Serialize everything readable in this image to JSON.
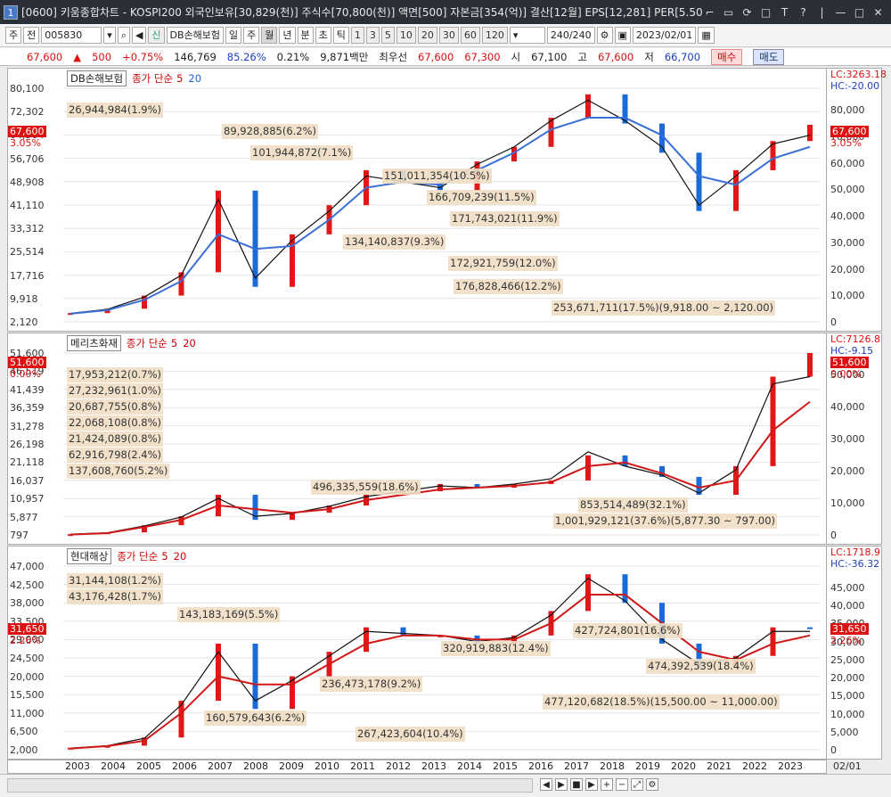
{
  "window": {
    "num": "1",
    "title": "[0600] 키움종합차트 - KOSPI200 외국인보유[30,829(천)] 주식수[70,800(천)] 액면[500] 자본금[354(억)] 결산[12월] EPS[12,281] PER[5.50] ∕",
    "controls": [
      "⌐",
      "▭",
      "⟳",
      "□",
      "T",
      "?",
      "|",
      "—",
      "□",
      "✕"
    ]
  },
  "toolbar": {
    "tab1": "주",
    "tab2": "전",
    "code": "005830",
    "name": "DB손해보험",
    "periods": [
      "일",
      "주",
      "월",
      "년",
      "분",
      "초",
      "틱"
    ],
    "selected_period": "월",
    "nums": [
      "1",
      "3",
      "5",
      "10",
      "20",
      "30",
      "60",
      "120"
    ],
    "count": "240/240",
    "date": "2023/02/01"
  },
  "quote": {
    "price": "67,600",
    "change": "500",
    "pct": "+0.75%",
    "volume": "146,769",
    "v1": "85.26%",
    "v2": "0.21%",
    "amount": "9,871백만",
    "best_label": "최우선",
    "ask": "67,600",
    "bid": "67,300",
    "open_label": "시",
    "open": "67,100",
    "high_label": "고",
    "high": "67,600",
    "low_label": "저",
    "low": "66,700",
    "buy": "매수",
    "sell": "매도"
  },
  "panes": [
    {
      "name": "DB손해보험",
      "ma_label": "종가 단순",
      "ma1": "5",
      "ma2": "20",
      "lc": "LC:3263.18",
      "hc": "HC:-20.00",
      "price_tag": "67,600",
      "pct_tag": "3.05%",
      "left_scale": [
        "80,100",
        "72,302",
        "64,504",
        "56,706",
        "48,908",
        "41,110",
        "33,312",
        "25,514",
        "17,716",
        "9,918",
        "2,120"
      ],
      "right_scale": [
        "80,000",
        "70,000",
        "60,000",
        "50,000",
        "40,000",
        "30,000",
        "20,000",
        "10,000",
        "0"
      ],
      "vols": [
        "26,944,984(1.9%)",
        "89,928,885(6.2%)",
        "101,944,872(7.1%)",
        "151,011,354(10.5%)",
        "166,709,239(11.5%)",
        "171,743,021(11.9%)",
        "134,140,837(9.3%)",
        "172,921,759(12.0%)",
        "176,828,466(12.2%)",
        "253,671,711(17.5%)(9,918.00 ~ 2,120.00)"
      ]
    },
    {
      "name": "메리츠화재",
      "ma_label": "종가 단순",
      "ma1": "5",
      "ma2": "20",
      "lc": "LC:7126.8",
      "hc": "HC:-9.15",
      "price_tag": "51,600",
      "pct_tag": "0.00%",
      "left_scale": [
        "51,600",
        "46,519",
        "41,439",
        "36,359",
        "31,278",
        "26,198",
        "21,118",
        "16,037",
        "10,957",
        "5,877",
        "797"
      ],
      "right_scale": [
        "50,000",
        "40,000",
        "30,000",
        "20,000",
        "10,000",
        "0"
      ],
      "vols": [
        "17,953,212(0.7%)",
        "27,232,961(1.0%)",
        "20,687,755(0.8%)",
        "22,068,108(0.8%)",
        "21,424,089(0.8%)",
        "62,916,798(2.4%)",
        "137,608,760(5.2%)",
        "496,335,559(18.6%)",
        "853,514,489(32.1%)",
        "1,001,929,121(37.6%)(5,877.30 ~ 797.00)"
      ]
    },
    {
      "name": "현대해상",
      "ma_label": "종가 단순",
      "ma1": "5",
      "ma2": "20",
      "lc": "LC:1718.9",
      "hc": "HC:-36.32",
      "price_tag": "31,650",
      "pct_tag": "2.26%",
      "left_scale": [
        "47,000",
        "42,500",
        "38,000",
        "33,500",
        "29,000",
        "24,500",
        "20,000",
        "15,500",
        "11,000",
        "6,500",
        "2,000"
      ],
      "right_scale": [
        "45,000",
        "40,000",
        "35,000",
        "30,000",
        "25,000",
        "20,000",
        "15,000",
        "10,000",
        "5,000",
        "0"
      ],
      "vols": [
        "31,144,108(1.2%)",
        "43,176,428(1.7%)",
        "143,183,169(5.5%)",
        "427,724,801(16.6%)",
        "320,919,883(12.4%)",
        "474,392,539(18.4%)",
        "236,473,178(9.2%)",
        "477,120,682(18.5%)(15,500.00 ~ 11,000.00)",
        "160,579,643(6.2%)",
        "267,423,604(10.4%)"
      ]
    }
  ],
  "years": [
    "2003",
    "2004",
    "2005",
    "2006",
    "2007",
    "2008",
    "2009",
    "2010",
    "2011",
    "2012",
    "2013",
    "2014",
    "2015",
    "2016",
    "2017",
    "2018",
    "2019",
    "2020",
    "2021",
    "2022",
    "2023"
  ],
  "date_axis_right": "02/01",
  "chart_data": [
    {
      "type": "candlestick",
      "title": "DB손해보험",
      "x": [
        "2003",
        "2004",
        "2005",
        "2006",
        "2007",
        "2008",
        "2009",
        "2010",
        "2011",
        "2012",
        "2013",
        "2014",
        "2015",
        "2016",
        "2017",
        "2018",
        "2019",
        "2020",
        "2021",
        "2022",
        "2023"
      ],
      "series": [
        {
          "name": "종가",
          "values": [
            3000,
            4500,
            9000,
            17000,
            45000,
            12000,
            30000,
            40000,
            52000,
            48000,
            45000,
            55000,
            60000,
            70000,
            78000,
            68000,
            58000,
            38000,
            52000,
            62000,
            67600
          ]
        },
        {
          "name": "5",
          "values": [
            2900,
            4300,
            8500,
            16000,
            42000,
            15000,
            28000,
            38000,
            50000,
            48000,
            46000,
            54000,
            60000,
            69000,
            76000,
            69000,
            60000,
            40000,
            50000,
            61000,
            64000
          ]
        },
        {
          "name": "20",
          "values": [
            2800,
            4000,
            7500,
            14000,
            30000,
            25000,
            26000,
            35000,
            46000,
            48000,
            47000,
            52000,
            58000,
            66000,
            70000,
            70000,
            64000,
            50000,
            47000,
            56000,
            60000
          ]
        }
      ],
      "ylim": [
        0,
        80100
      ]
    },
    {
      "type": "candlestick",
      "title": "메리츠화재",
      "x": [
        "2003",
        "2004",
        "2005",
        "2006",
        "2007",
        "2008",
        "2009",
        "2010",
        "2011",
        "2012",
        "2013",
        "2014",
        "2015",
        "2016",
        "2017",
        "2018",
        "2019",
        "2020",
        "2021",
        "2022",
        "2023"
      ],
      "series": [
        {
          "name": "종가",
          "values": [
            1000,
            1500,
            3500,
            6000,
            12000,
            5000,
            7000,
            9000,
            12000,
            13000,
            15000,
            14000,
            15000,
            16000,
            23000,
            20000,
            17000,
            12000,
            20000,
            45000,
            51600
          ]
        },
        {
          "name": "5",
          "values": [
            1000,
            1400,
            3300,
            5800,
            11000,
            6000,
            6800,
            8800,
            11500,
            13000,
            14500,
            14000,
            15000,
            16500,
            24000,
            20000,
            17500,
            12500,
            19000,
            43000,
            45000
          ]
        },
        {
          "name": "20",
          "values": [
            900,
            1300,
            3000,
            5000,
            9000,
            8000,
            7000,
            8000,
            10500,
            12000,
            13500,
            14000,
            14500,
            15500,
            20000,
            21000,
            18000,
            14000,
            16000,
            30000,
            38000
          ]
        }
      ],
      "ylim": [
        797,
        51600
      ]
    },
    {
      "type": "candlestick",
      "title": "현대해상",
      "x": [
        "2003",
        "2004",
        "2005",
        "2006",
        "2007",
        "2008",
        "2009",
        "2010",
        "2011",
        "2012",
        "2013",
        "2014",
        "2015",
        "2016",
        "2017",
        "2018",
        "2019",
        "2020",
        "2021",
        "2022",
        "2023"
      ],
      "series": [
        {
          "name": "종가",
          "values": [
            2500,
            3000,
            5000,
            14000,
            28000,
            12000,
            20000,
            26000,
            32000,
            30000,
            30000,
            28000,
            30000,
            36000,
            45000,
            38000,
            28000,
            22000,
            25000,
            32000,
            31650
          ]
        },
        {
          "name": "5",
          "values": [
            2400,
            3000,
            4800,
            13000,
            26000,
            14000,
            19000,
            25000,
            31000,
            30500,
            30000,
            28500,
            29500,
            35000,
            44000,
            38500,
            29000,
            23000,
            24500,
            31000,
            31000
          ]
        },
        {
          "name": "20",
          "values": [
            2300,
            2900,
            4200,
            11000,
            20000,
            18000,
            18000,
            23000,
            28000,
            30000,
            30000,
            29000,
            29000,
            33000,
            40000,
            40000,
            33000,
            26000,
            24000,
            28000,
            30000
          ]
        }
      ],
      "ylim": [
        2000,
        47000
      ]
    }
  ]
}
